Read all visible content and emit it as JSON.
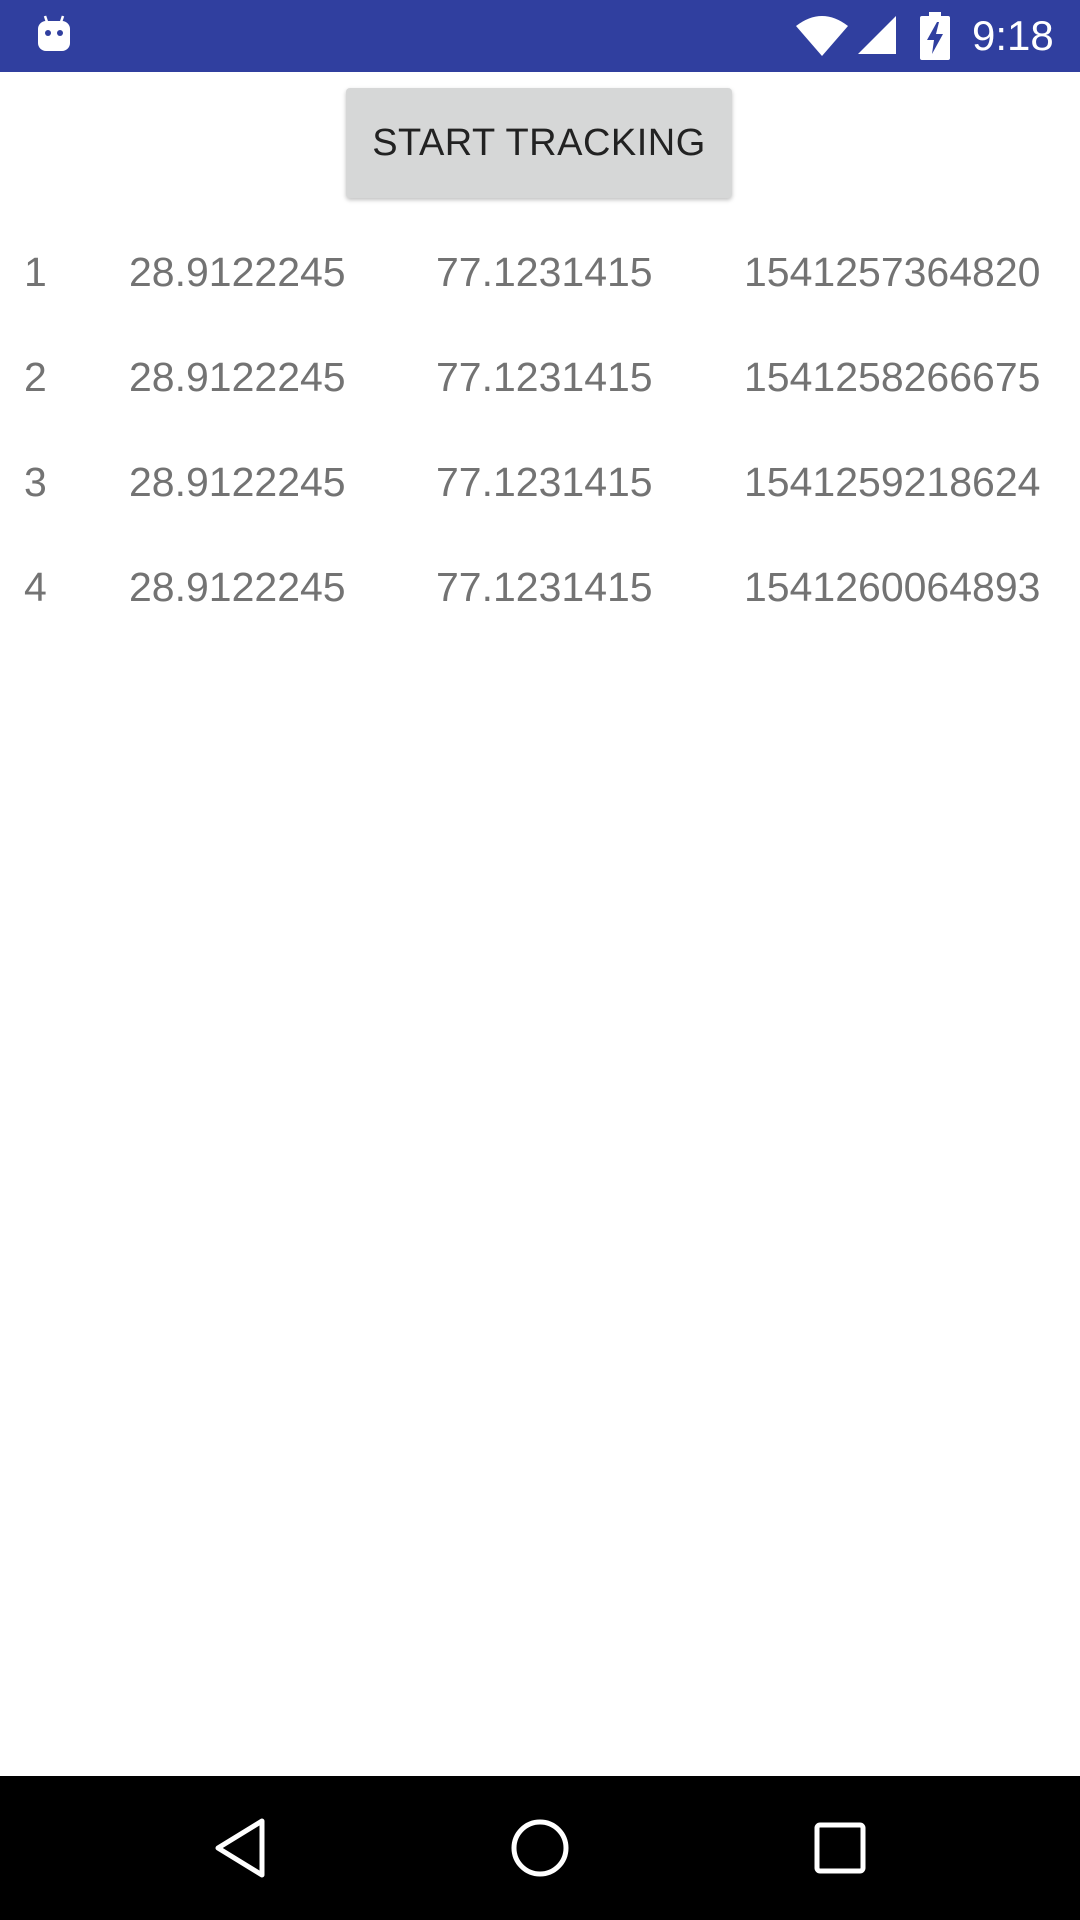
{
  "status_bar": {
    "time": "9:18",
    "notification_icon": "android-debug-icon",
    "wifi_icon": "wifi-icon",
    "signal_icon": "cell-signal-icon",
    "battery_icon": "battery-charging-icon",
    "background_color": "#303F9F"
  },
  "main": {
    "start_button_label": "START TRACKING",
    "rows": [
      {
        "index": "1",
        "latitude": "28.9122245",
        "longitude": "77.1231415",
        "timestamp": "1541257364820"
      },
      {
        "index": "2",
        "latitude": "28.9122245",
        "longitude": "77.1231415",
        "timestamp": "1541258266675"
      },
      {
        "index": "3",
        "latitude": "28.9122245",
        "longitude": "77.1231415",
        "timestamp": "1541259218624"
      },
      {
        "index": "4",
        "latitude": "28.9122245",
        "longitude": "77.1231415",
        "timestamp": "1541260064893"
      }
    ]
  },
  "nav_bar": {
    "back_icon": "back-triangle-icon",
    "home_icon": "home-circle-icon",
    "recents_icon": "recents-square-icon"
  }
}
